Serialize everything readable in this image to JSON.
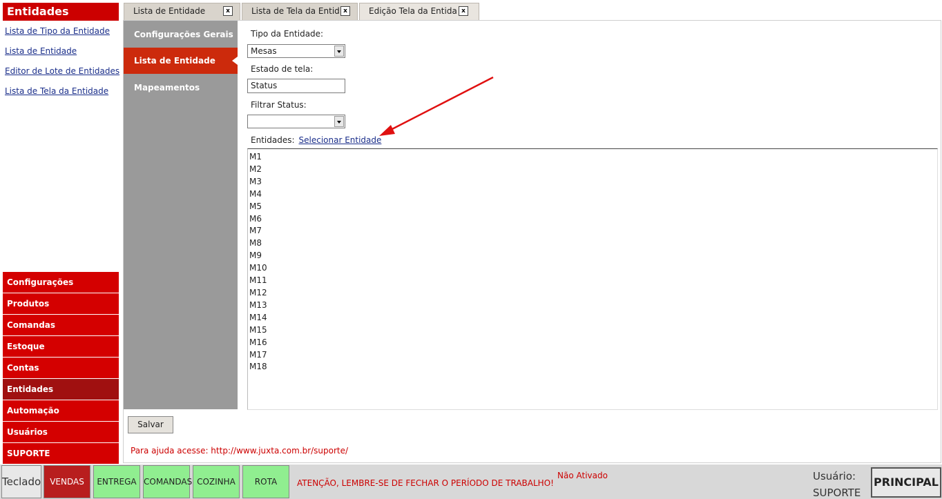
{
  "sidebar": {
    "title": "Entidades",
    "links": [
      {
        "label": "Lista de Tipo da Entidade"
      },
      {
        "label": "Lista de Entidade"
      },
      {
        "label": "Editor de Lote de Entidades"
      },
      {
        "label": "Lista de Tela da Entidade"
      }
    ],
    "menu": [
      {
        "label": "Configurações"
      },
      {
        "label": "Produtos"
      },
      {
        "label": "Comandas"
      },
      {
        "label": "Estoque"
      },
      {
        "label": "Contas"
      },
      {
        "label": "Entidades"
      },
      {
        "label": "Automação"
      },
      {
        "label": "Usuários"
      },
      {
        "label": "SUPORTE"
      }
    ]
  },
  "tabs": [
    {
      "label": "Lista de Entidade",
      "close": "x"
    },
    {
      "label": "Lista de Tela da Entida",
      "close": "x"
    },
    {
      "label": "Edição Tela da Entida",
      "close": "x"
    }
  ],
  "vtabs": [
    {
      "label": "Configurações Gerais"
    },
    {
      "label": "Lista de Entidade"
    },
    {
      "label": "Mapeamentos"
    }
  ],
  "form": {
    "tipo_label": "Tipo da Entidade:",
    "tipo_value": "Mesas",
    "estado_label": "Estado de tela:",
    "estado_value": "Status",
    "filtrar_label": "Filtrar Status:",
    "filtrar_value": "",
    "entidades_label": "Entidades:",
    "selecionar_link": "Selecionar Entidade",
    "entities": [
      "M1",
      "M2",
      "M3",
      "M4",
      "M5",
      "M6",
      "M7",
      "M8",
      "M9",
      "M10",
      "M11",
      "M12",
      "M13",
      "M14",
      "M15",
      "M16",
      "M17",
      "M18"
    ]
  },
  "save_label": "Salvar",
  "help_text": "Para ajuda acesse: http://www.juxta.com.br/suporte/",
  "bottom": {
    "teclado": "Teclado",
    "vendas": "VENDAS",
    "entrega": "ENTREGA",
    "comandas": "COMANDAS",
    "cozinha": "COZINHA",
    "rota": "ROTA",
    "warning": "ATENÇÃO, LEMBRE-SE DE FECHAR O PERÍODO DE TRABALHO!",
    "status": "Não Ativado",
    "user_label": "Usuário:",
    "user_name": "SUPORTE",
    "principal": "PRINCIPAL"
  },
  "colors": {
    "brand_red": "#cc0000",
    "active_red": "#a01010",
    "vtab_active": "#cc2a0c",
    "green_button": "#90ee90",
    "annotation_arrow": "#e01010"
  }
}
